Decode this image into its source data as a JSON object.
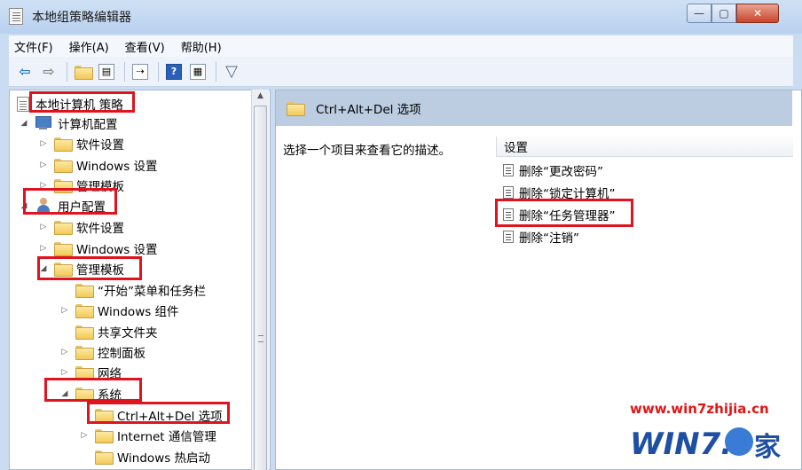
{
  "window": {
    "title": "本地组策略编辑器",
    "min_glyph": "—",
    "max_glyph": "▢",
    "close_glyph": "✕"
  },
  "menu": {
    "items": [
      "文件(F)",
      "操作(A)",
      "查看(V)",
      "帮助(H)"
    ]
  },
  "toolbar": {
    "icons": [
      "back-arrow-icon",
      "forward-arrow-icon",
      "up-folder-icon",
      "show-hide-tree-icon",
      "export-list-icon",
      "help-icon",
      "properties-icon",
      "filter-icon"
    ],
    "help_glyph": "?"
  },
  "tree": {
    "root": "本地计算机 策略",
    "computer_config": "计算机配置",
    "computer_software": "软件设置",
    "computer_windows": "Windows 设置",
    "computer_admin": "管理模板",
    "user_config": "用户配置",
    "user_software": "软件设置",
    "user_windows": "Windows 设置",
    "user_admin": "管理模板",
    "start_menu": "“开始”菜单和任务栏",
    "windows_components": "Windows 组件",
    "shared_folders": "共享文件夹",
    "control_panel": "控制面板",
    "network": "网络",
    "system": "系统",
    "ctrl_alt_del": "Ctrl+Alt+Del 选项",
    "internet_comm": "Internet 通信管理",
    "windows_hotstart": "Windows 热启动"
  },
  "right": {
    "header": "Ctrl+Alt+Del 选项",
    "description": "选择一个项目来查看它的描述。",
    "settings_column": "设置",
    "settings": [
      "删除“更改密码”",
      "删除“锁定计算机”",
      "删除“任务管理器”",
      "删除“注销”"
    ]
  },
  "watermark": {
    "url": "www.win7zhijia.cn",
    "logo_text": "WIN7.",
    "logo_cn": "家"
  },
  "colors": {
    "highlight": "#e0141e",
    "header_bg": "#bccde2"
  }
}
